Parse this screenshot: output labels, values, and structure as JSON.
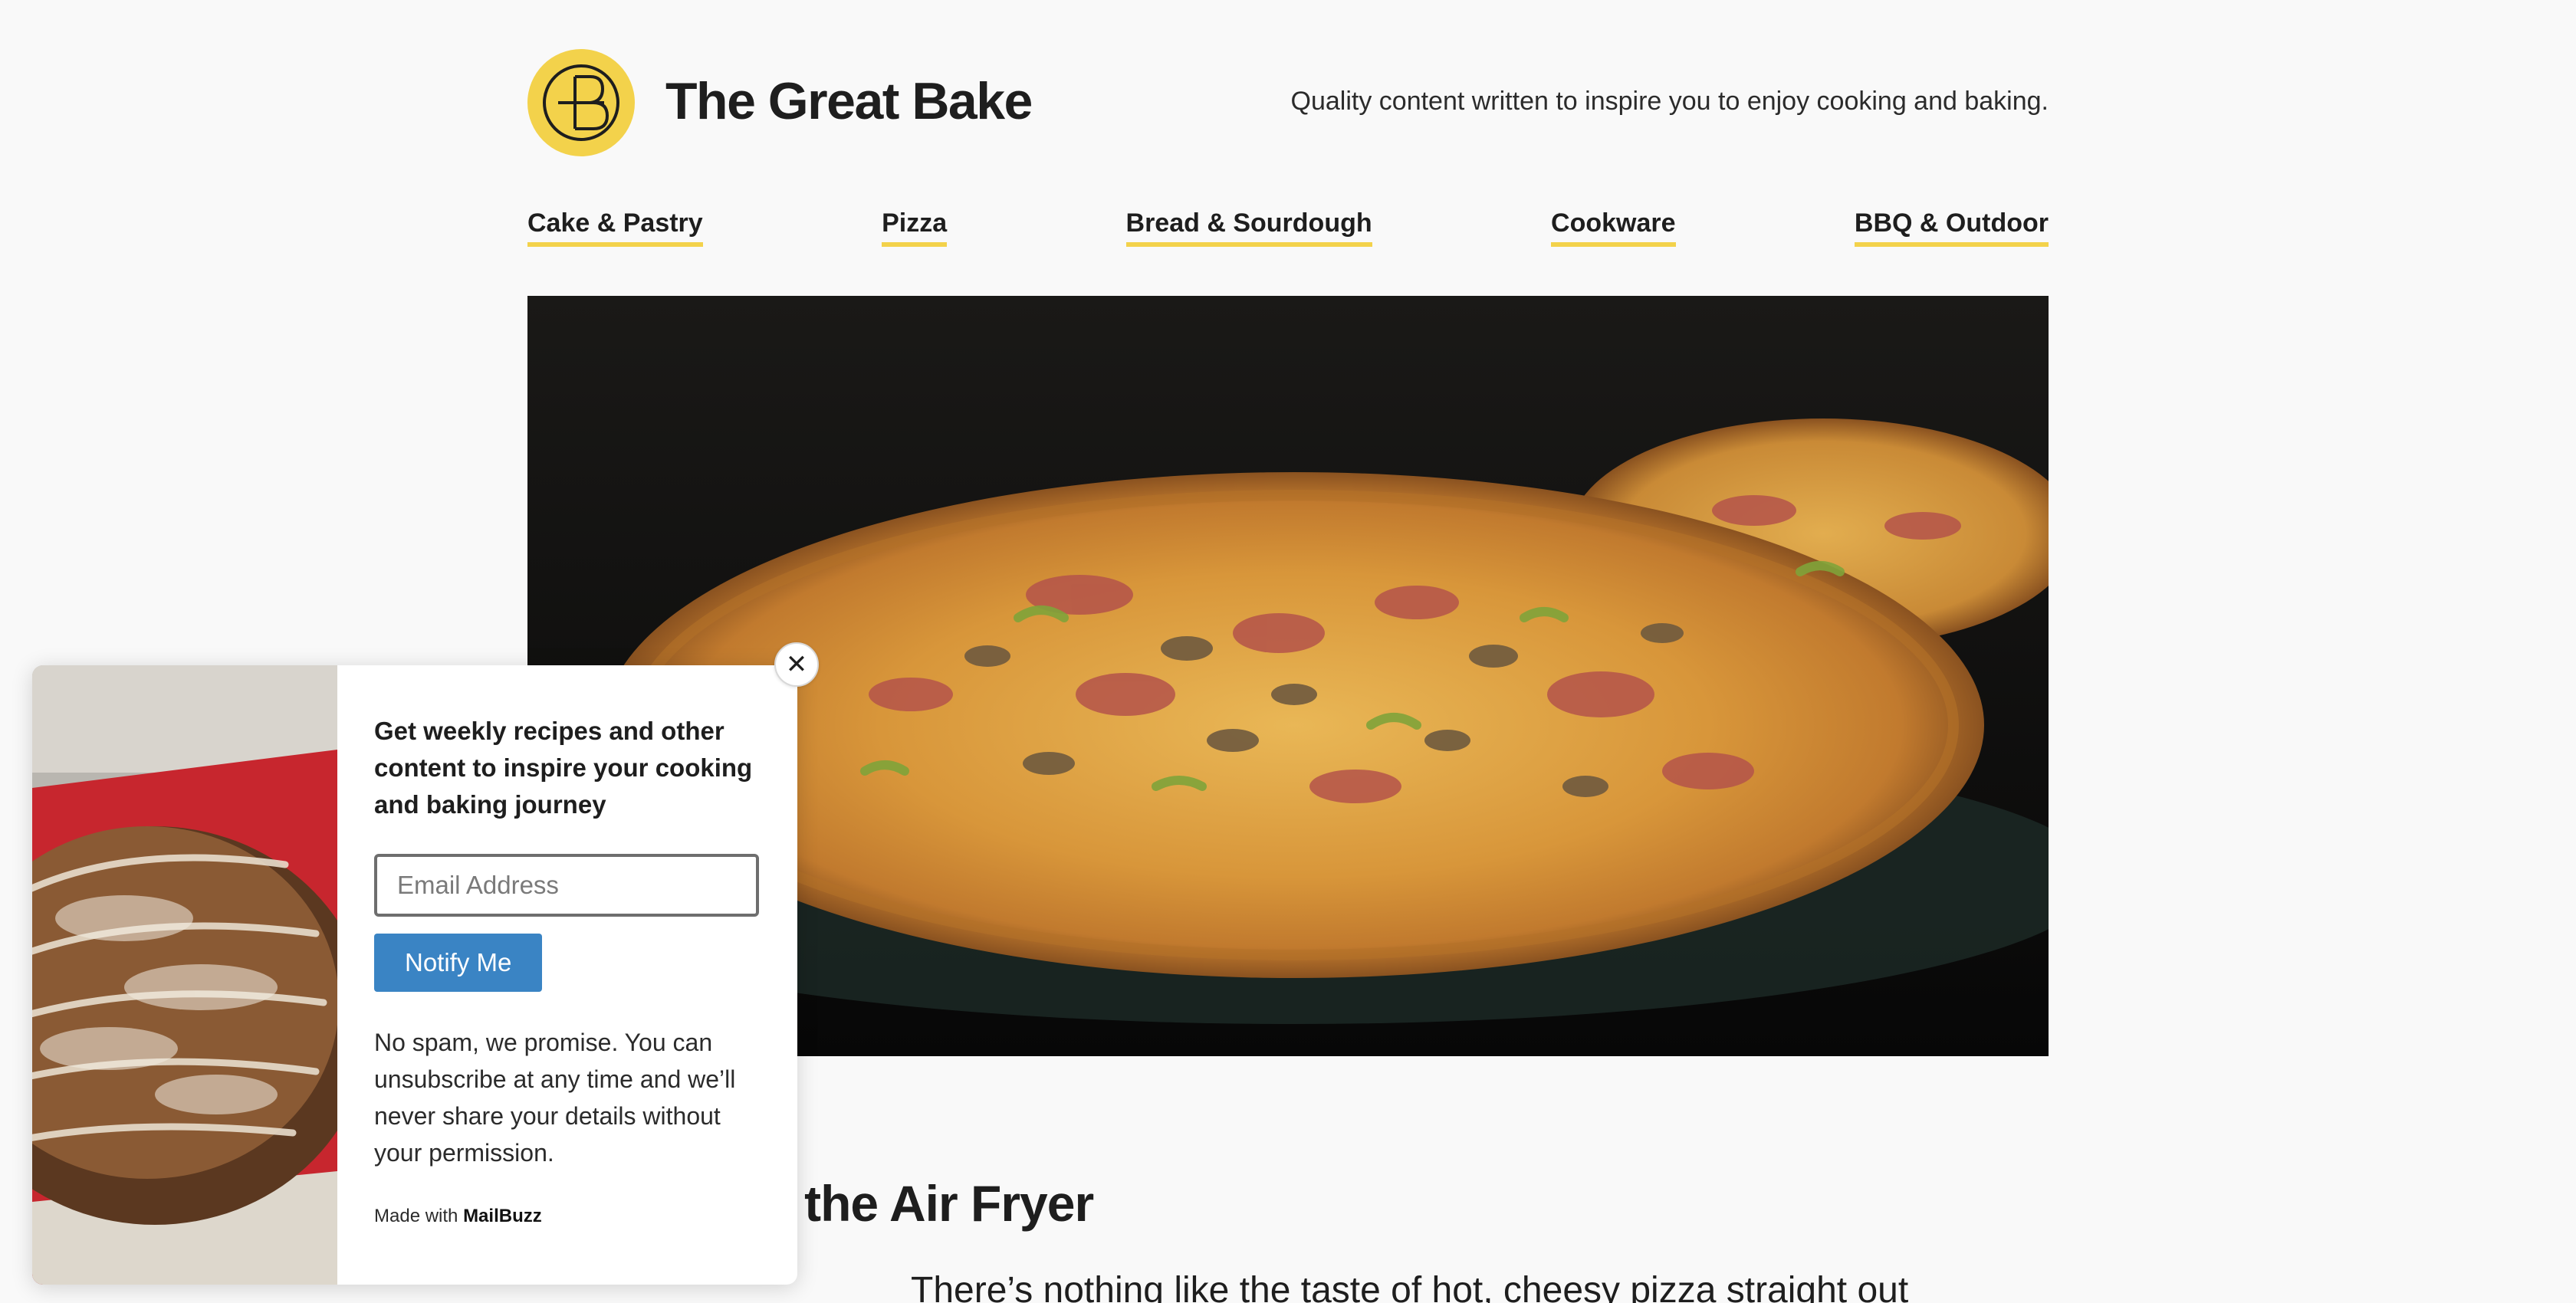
{
  "header": {
    "site_title": "The Great Bake",
    "tagline": "Quality content written to inspire you to enjoy cooking and baking.",
    "logo_icon": "monogram-tgb-logo",
    "accent_color": "#f3d24b"
  },
  "nav": {
    "items": [
      {
        "label": "Cake & Pastry"
      },
      {
        "label": "Pizza"
      },
      {
        "label": "Bread & Sourdough"
      },
      {
        "label": "Cookware"
      },
      {
        "label": "BBQ & Outdoor"
      }
    ]
  },
  "hero": {
    "image_subject": "pizza-photo"
  },
  "article": {
    "title_visible": "eat Pizza in the Air Fryer",
    "intro_visible": "There’s nothing like the taste of hot, cheesy pizza straight out"
  },
  "popup": {
    "heading": "Get weekly recipes and other content to inspire your cooking and baking journey",
    "email_placeholder": "Email Address",
    "button_label": "Notify Me",
    "button_color": "#3a84c4",
    "disclaimer": "No spam, we promise. You can unsubscribe at any time and we’ll never share your details without your permission.",
    "made_with_prefix": "Made with",
    "made_with_brand": "MailBuzz",
    "close_icon": "close-icon",
    "image_subject": "sourdough-bread-photo"
  }
}
